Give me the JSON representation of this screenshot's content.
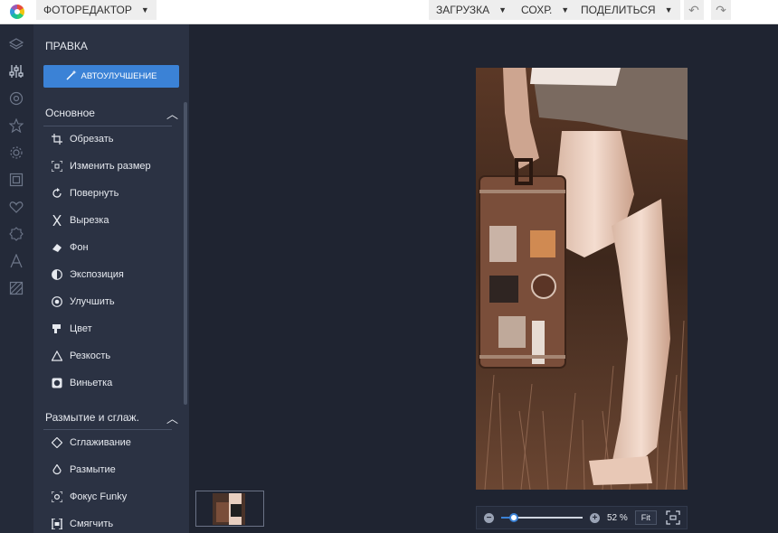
{
  "topbar": {
    "app_menu": "ФОТОРЕДАКТОР",
    "upload": "ЗАГРУЗКА",
    "save": "СОХР.",
    "share": "ПОДЕЛИТЬСЯ",
    "undo_icon": "undo-icon",
    "redo_icon": "redo-icon"
  },
  "rail": {
    "icons": [
      "layers-icon",
      "sliders-icon",
      "eye-icon",
      "star-icon",
      "gear-icon",
      "frame-icon",
      "heart-icon",
      "badge-icon",
      "text-icon",
      "texture-icon"
    ],
    "active": "sliders-icon"
  },
  "panel": {
    "title": "ПРАВКА",
    "auto_enhance": "АВТОУЛУЧШЕНИЕ",
    "sections": [
      {
        "title": "Основное",
        "tools": [
          "Обрезать",
          "Изменить размер",
          "Повернуть",
          "Вырезка",
          "Фон",
          "Экспозиция",
          "Улучшить",
          "Цвет",
          "Резкость",
          "Виньетка"
        ]
      },
      {
        "title": "Размытие и сглаж.",
        "tools": [
          "Сглаживание",
          "Размытие",
          "Фокус Funky",
          "Смягчить"
        ]
      }
    ]
  },
  "canvas": {
    "zoom_percent": "52 %",
    "zoom_level": 0.15,
    "fit_label": "Fit"
  },
  "colors": {
    "accent": "#3b82d6",
    "background": "#1f2431",
    "panel": "#2b3243"
  }
}
